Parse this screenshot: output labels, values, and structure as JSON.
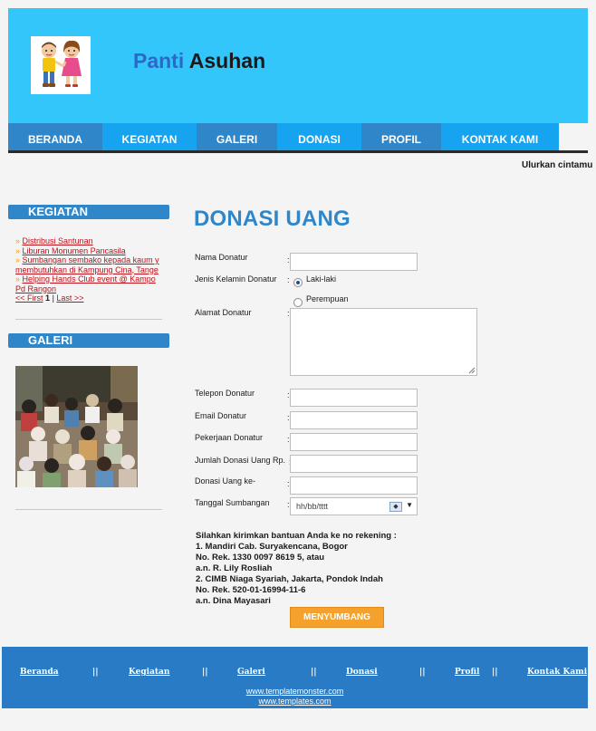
{
  "header": {
    "title_part1": "Panti",
    "title_part2": "Asuhan"
  },
  "nav": {
    "items": [
      {
        "label": "BERANDA",
        "color": "#2f86c9"
      },
      {
        "label": "KEGIATAN",
        "color": "#16a3ef"
      },
      {
        "label": "GALERI",
        "color": "#2f86c9"
      },
      {
        "label": "DONASI",
        "color": "#16a3ef"
      },
      {
        "label": "PROFIL",
        "color": "#2f86c9"
      },
      {
        "label": "KONTAK KAMI",
        "color": "#16a3ef"
      }
    ]
  },
  "marquee": "Ulurkan cintamu",
  "sidebar": {
    "kegiatan_title": "KEGIATAN",
    "links": [
      "Distribusi Santunan",
      "Liburan Monumen Pancasila",
      "Sumbangan sembako kepada kaum y",
      "membutuhkan di Kampung Cina, Tange",
      "Helping Hands Club event @ Kampo",
      "Pd Rangon"
    ],
    "pager": {
      "first": "<< First",
      "page": "1",
      "sep": "|",
      "last": "Last >>"
    },
    "galeri_title": "GALERI"
  },
  "main": {
    "title": "DONASI UANG",
    "fields": {
      "nama": "Nama Donatur",
      "jenis_kelamin": "Jenis Kelamin Donatur",
      "alamat": "Alamat Donatur",
      "telepon": "Telepon Donatur",
      "email": "Email Donatur",
      "pekerjaan": "Pekerjaan Donatur",
      "jumlah": "Jumlah Donasi Uang Rp.",
      "donasi_ke": "Donasi Uang ke-",
      "tanggal": "Tanggal Sumbangan"
    },
    "colon": ":",
    "gender": {
      "male": "Laki-laki",
      "female": "Perempuan",
      "selected": "Laki-laki"
    },
    "date_placeholder": "hh/bb/tttt",
    "info_lines": [
      "Silahkan kirimkan bantuan Anda ke no rekening :",
      "1. Mandiri Cab. Suryakencana, Bogor",
      "No. Rek. 1330 0097 8619 5, atau",
      "a.n. R. Lily Rosliah",
      "2. CIMB Niaga Syariah, Jakarta, Pondok Indah",
      "No. Rek. 520-01-16994-11-6",
      "a.n. Dina Mayasari"
    ],
    "submit_label": "MENYUMBANG"
  },
  "footer": {
    "links": [
      "Beranda",
      "Kegiatan",
      "Galeri",
      "Donasi",
      "Profil",
      "Kontak Kami"
    ],
    "separator": "||",
    "credit1": "www.templatemonster.com",
    "credit2": "www.templates.com"
  },
  "colors": {
    "header_bg": "#33c6fb",
    "accent": "#2f86c9",
    "button": "#f5a12d",
    "footer_bg": "#2a7bc5"
  }
}
